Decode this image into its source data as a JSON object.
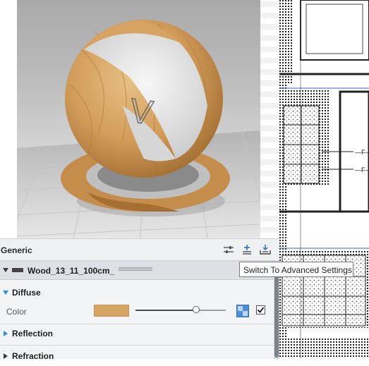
{
  "panel": {
    "title": "Generic",
    "header_icons": [
      "sliders-icon",
      "add-parameter-icon",
      "apply-to-selection-icon"
    ]
  },
  "material": {
    "name": "Wood_13_11_100cm_",
    "swatch_icon": "material-swatch-icon"
  },
  "sections": {
    "diffuse": {
      "label": "Diffuse",
      "expanded": true
    },
    "reflection": {
      "label": "Reflection",
      "expanded": false
    },
    "refraction": {
      "label": "Refraction",
      "expanded": false
    }
  },
  "diffuse": {
    "color_label": "Color",
    "color_hex": "#d6a463",
    "slider_fraction": 0.67,
    "map_icon": "texture-map-icon",
    "checked": true
  },
  "tooltip": {
    "text": "Switch To Advanced Settings"
  },
  "preview": {
    "sphere_text": "V",
    "colors": {
      "wood_light": "#d9a868",
      "wood_dark": "#b9803f",
      "band": "#e9e9e9",
      "floor_grid": "#c9c9c9"
    }
  },
  "colors": {
    "accent": "#2f8fd8",
    "panel_bg": "#f3f4f6",
    "row_bg": "#dde0e4"
  }
}
